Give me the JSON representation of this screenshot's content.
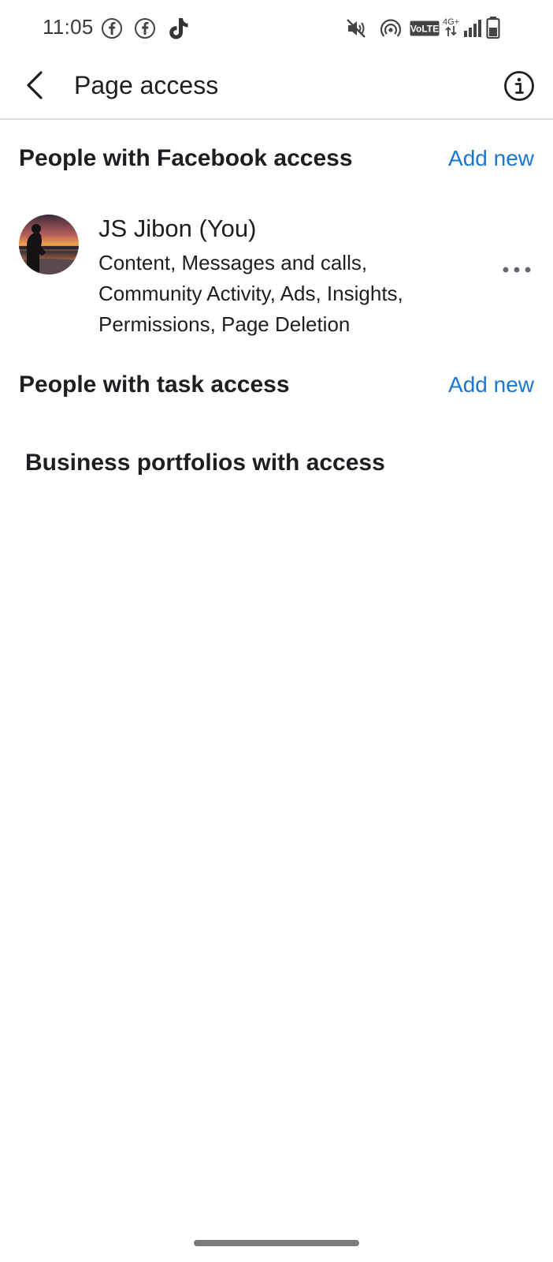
{
  "status_bar": {
    "time": "11:05",
    "notification_icons": [
      "facebook-icon",
      "facebook-icon",
      "tiktok-icon"
    ],
    "system_icons": [
      "mute-icon",
      "hotspot-icon",
      "volte-icon",
      "4g-icon",
      "signal-icon",
      "battery-icon"
    ],
    "volte_label": "VoLTE",
    "network_label": "4G+"
  },
  "app_bar": {
    "title": "Page access",
    "back_icon": "chevron-left-icon",
    "info_icon": "info-icon"
  },
  "facebook_access": {
    "title": "People with Facebook access",
    "add_label": "Add new",
    "people": [
      {
        "name": "JS Jibon (You)",
        "permissions": "Content, Messages and calls, Community Activity, Ads, Insights, Permissions, Page Deletion"
      }
    ]
  },
  "task_access": {
    "title": "People with task access",
    "add_label": "Add new"
  },
  "business_portfolios": {
    "title": "Business portfolios with access"
  },
  "colors": {
    "link": "#1877d2",
    "text": "#1c1e21",
    "divider": "#dadde1"
  }
}
